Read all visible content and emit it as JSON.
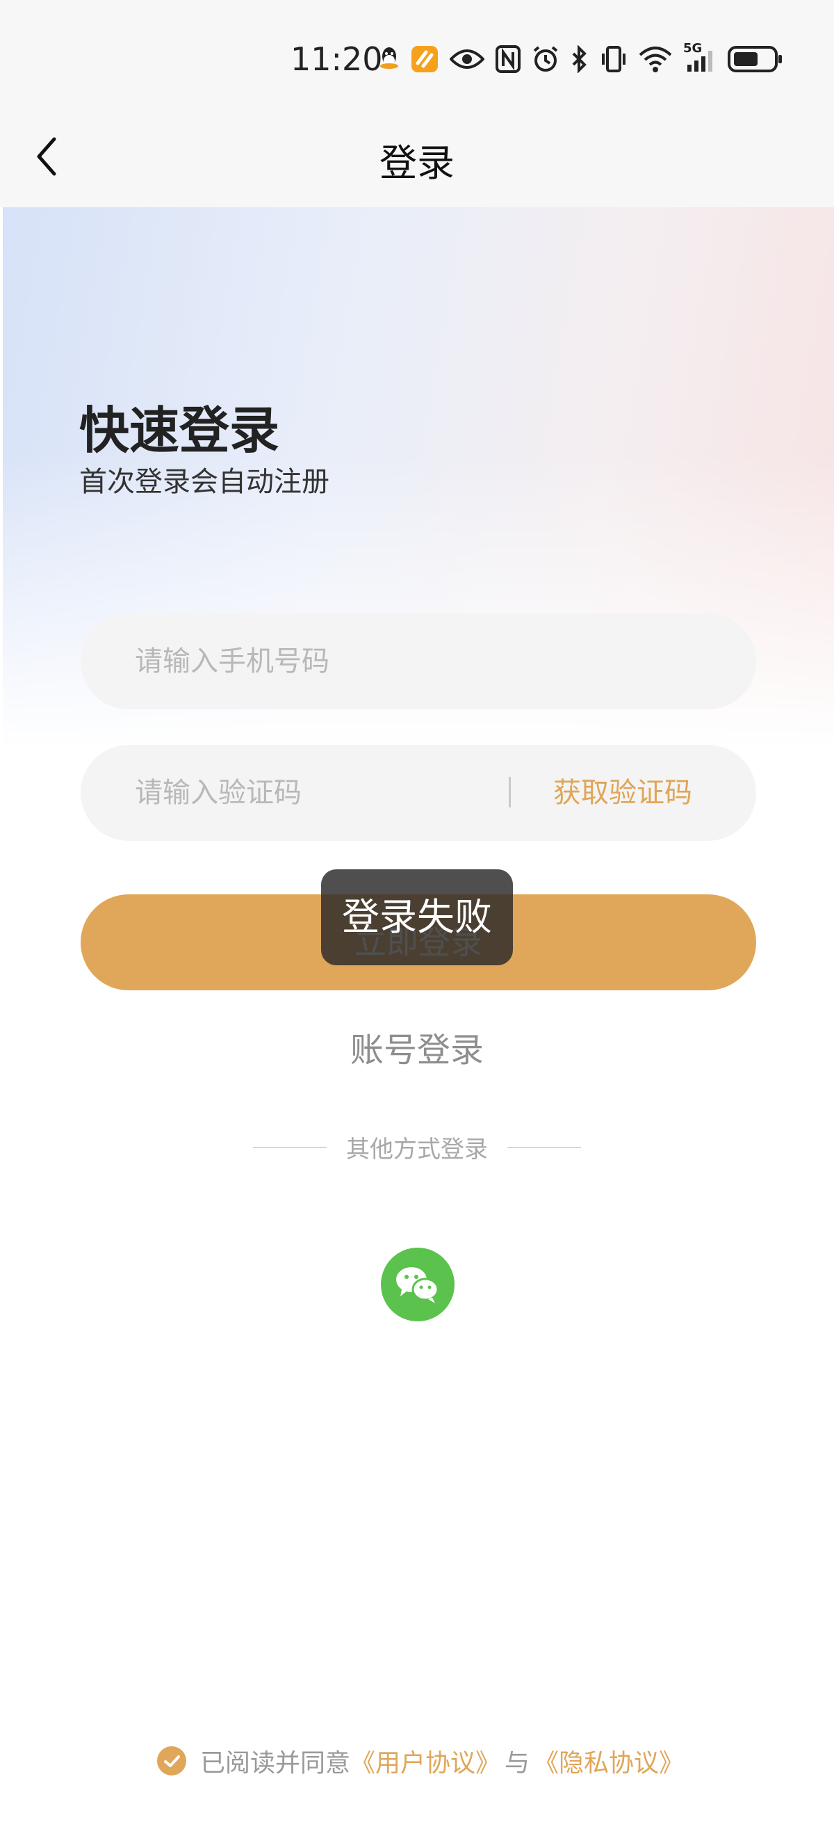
{
  "status_bar": {
    "time": "11:20",
    "icons": [
      "qq-icon",
      "app-notification-icon",
      "eye-icon",
      "nfc-icon",
      "alarm-icon",
      "bluetooth-icon",
      "vibrate-icon",
      "wifi-icon",
      "5g-signal-icon",
      "battery-icon"
    ],
    "network_label": "5G"
  },
  "nav": {
    "title": "登录"
  },
  "hero": {
    "title": "快速登录",
    "subtitle": "首次登录会自动注册"
  },
  "form": {
    "phone_placeholder": "请输入手机号码",
    "code_placeholder": "请输入验证码",
    "get_code_label": "获取验证码",
    "login_label": "立即登录"
  },
  "account_login_label": "账号登录",
  "other_methods_label": "其他方式登录",
  "agreement": {
    "checked": true,
    "prefix": "已阅读并同意",
    "user_agreement": "《用户协议》",
    "conjunction": "与",
    "privacy_agreement": "《隐私协议》"
  },
  "toast": {
    "message": "登录失败"
  },
  "colors": {
    "accent": "#e0a659",
    "wechat": "#5bc24d",
    "toast_bg": "#282828"
  }
}
